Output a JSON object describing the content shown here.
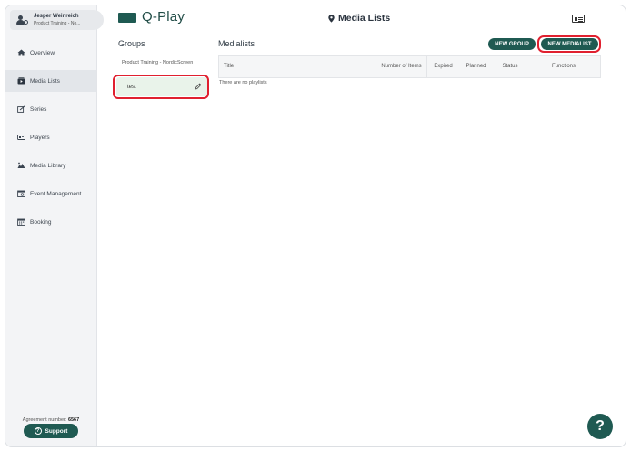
{
  "user": {
    "name": "Jesper Weinreich",
    "org": "Product Training - No..."
  },
  "sidebar": {
    "items": [
      {
        "label": "Overview",
        "icon": "home-icon",
        "active": false
      },
      {
        "label": "Media Lists",
        "icon": "media-list-icon",
        "active": true
      },
      {
        "label": "Series",
        "icon": "series-icon",
        "active": false
      },
      {
        "label": "Players",
        "icon": "players-icon",
        "active": false
      },
      {
        "label": "Media Library",
        "icon": "media-library-icon",
        "active": false
      },
      {
        "label": "Event Management",
        "icon": "event-icon",
        "active": false
      },
      {
        "label": "Booking",
        "icon": "booking-icon",
        "active": false
      }
    ],
    "agreement_label": "Agreement number:",
    "agreement_number": "6567",
    "support_label": "Support",
    "support_icon": "?"
  },
  "header": {
    "logo_text": "Q-Play",
    "page_title": "Media Lists"
  },
  "groups": {
    "title": "Groups",
    "parent": "Product Training - NordicScreen",
    "selected": "test"
  },
  "medialists": {
    "title": "Medialists",
    "new_group_label": "NEW GROUP",
    "new_medialist_label": "NEW MEDIALIST",
    "columns": {
      "title": "Title",
      "number_of_items": "Number of Items",
      "expired": "Expired",
      "planned": "Planned",
      "status": "Status",
      "functions": "Functions"
    },
    "empty_text": "There are no playlists"
  },
  "help_label": "?",
  "colors": {
    "brand": "#1f5a52",
    "highlight": "#e0202f",
    "selected_bg": "#e9f3ea"
  }
}
